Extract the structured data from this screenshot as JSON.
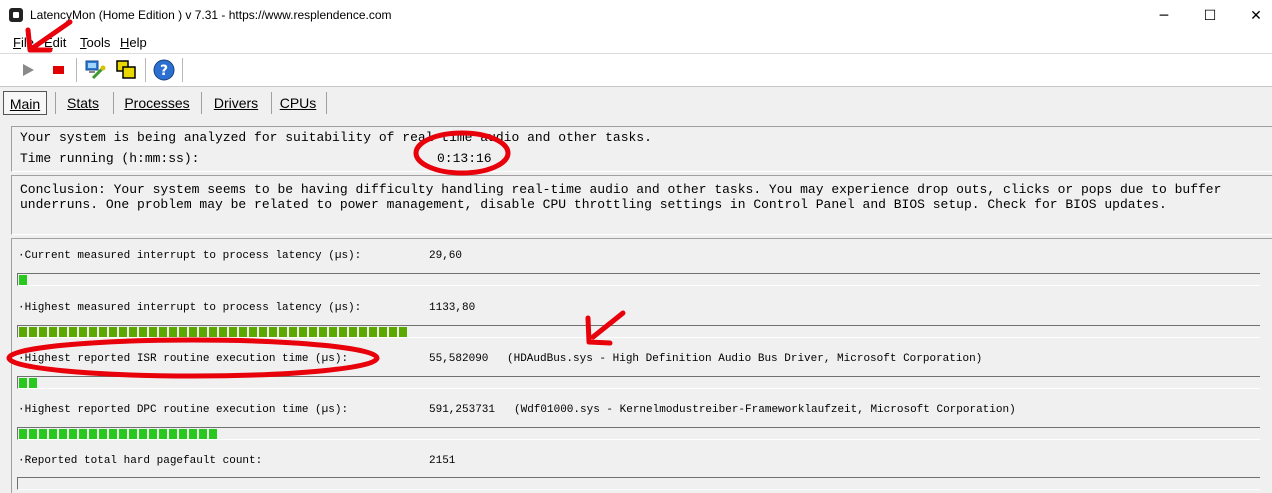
{
  "window": {
    "title": "LatencyMon  (Home Edition )  v 7.31 - https://www.resplendence.com",
    "minimize_glyph": "─",
    "maximize_glyph": "☐",
    "close_glyph": "✕"
  },
  "menu": [
    {
      "label": "File"
    },
    {
      "label": "Edit"
    },
    {
      "label": "Tools"
    },
    {
      "label": "Help"
    }
  ],
  "toolbar": {
    "icons": [
      "play-icon",
      "stop-icon",
      "network-tool-icon",
      "windows-icon",
      "help-icon"
    ],
    "help_glyph": "?"
  },
  "tabs": [
    {
      "label": "Main",
      "active": true
    },
    {
      "label": "Stats",
      "active": false
    },
    {
      "label": "Processes",
      "active": false
    },
    {
      "label": "Drivers",
      "active": false
    },
    {
      "label": "CPUs",
      "active": false
    }
  ],
  "status": {
    "analyzing_text": "Your system is being analyzed for suitability of real-time audio and other tasks.",
    "time_label": "Time running (h:mm:ss):",
    "time_value": "0:13:16"
  },
  "conclusion": {
    "line1": "Conclusion: Your system seems to be having difficulty handling real-time audio and other tasks. You may experience drop outs, clicks or pops due to buffer",
    "line2": "underruns. One problem may be related to power management, disable CPU throttling settings in Control Panel and BIOS setup. Check for BIOS updates."
  },
  "stats": [
    {
      "label": "·Current measured interrupt to process latency (µs):",
      "value": "29,60",
      "detail": "",
      "bar_fraction": 0.009
    },
    {
      "label": "·Highest measured interrupt to process latency (µs):",
      "value": "1133,80",
      "detail": "",
      "bar_fraction": 0.318
    },
    {
      "label": "·Highest reported ISR routine execution time (µs):",
      "value": "55,582090",
      "detail": "(HDAudBus.sys - High Definition Audio Bus Driver, Microsoft Corporation)",
      "bar_fraction": 0.018
    },
    {
      "label": "·Highest reported DPC routine execution time (µs):",
      "value": "591,253731",
      "detail": "(Wdf01000.sys - Kernelmodustreiber-Frameworklaufzeit, Microsoft Corporation)",
      "bar_fraction": 0.163
    },
    {
      "label": "·Reported total hard pagefault count:",
      "value": "2151",
      "detail": ""
    }
  ],
  "colors": {
    "bar_green": "#28c81e",
    "bar_olive": "#5aa800",
    "annotation_red": "#e8000b"
  }
}
